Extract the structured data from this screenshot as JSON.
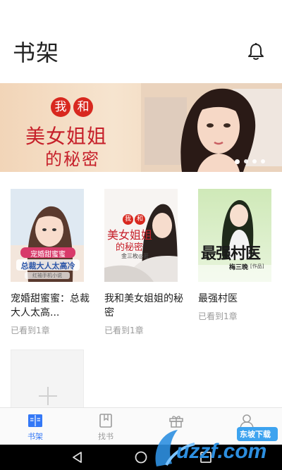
{
  "header": {
    "title": "书架",
    "bell_icon": "bell-icon"
  },
  "banner": {
    "circle_chars": [
      "我",
      "和"
    ],
    "line2": "美女姐姐",
    "line3": "的秘密",
    "slide_count": 4,
    "active_slide": 0
  },
  "books": [
    {
      "name": "宠婚甜蜜蜜：总裁大人太高...",
      "progress": "已看到1章",
      "cover_text": [
        "宠婚甜蜜蜜",
        "总裁大人太高冷",
        "红袖手机小说"
      ]
    },
    {
      "name": "我和美女姐姐的秘密",
      "progress": "已看到1章",
      "cover_text": [
        "我",
        "和",
        "美女姐姐",
        "的秘密",
        "金三枚◎著"
      ]
    },
    {
      "name": "最强村医",
      "progress": "已看到1章",
      "cover_text": [
        "最强村医",
        "梅三晚",
        "[作品]"
      ]
    }
  ],
  "add_slot": {
    "icon": "plus-icon"
  },
  "tabs": [
    {
      "label": "书架",
      "icon": "bookshelf-icon",
      "active": true
    },
    {
      "label": "找书",
      "icon": "book-icon",
      "active": false
    },
    {
      "label": "",
      "icon": "gift-icon",
      "active": false
    },
    {
      "label": "",
      "icon": "user-icon",
      "active": false
    }
  ],
  "watermark": {
    "text": "uzzf.com",
    "badge": "东坡下载"
  },
  "colors": {
    "accent": "#3478f6",
    "banner_red": "#c6202a",
    "tab_inactive": "#9b9b9b"
  }
}
